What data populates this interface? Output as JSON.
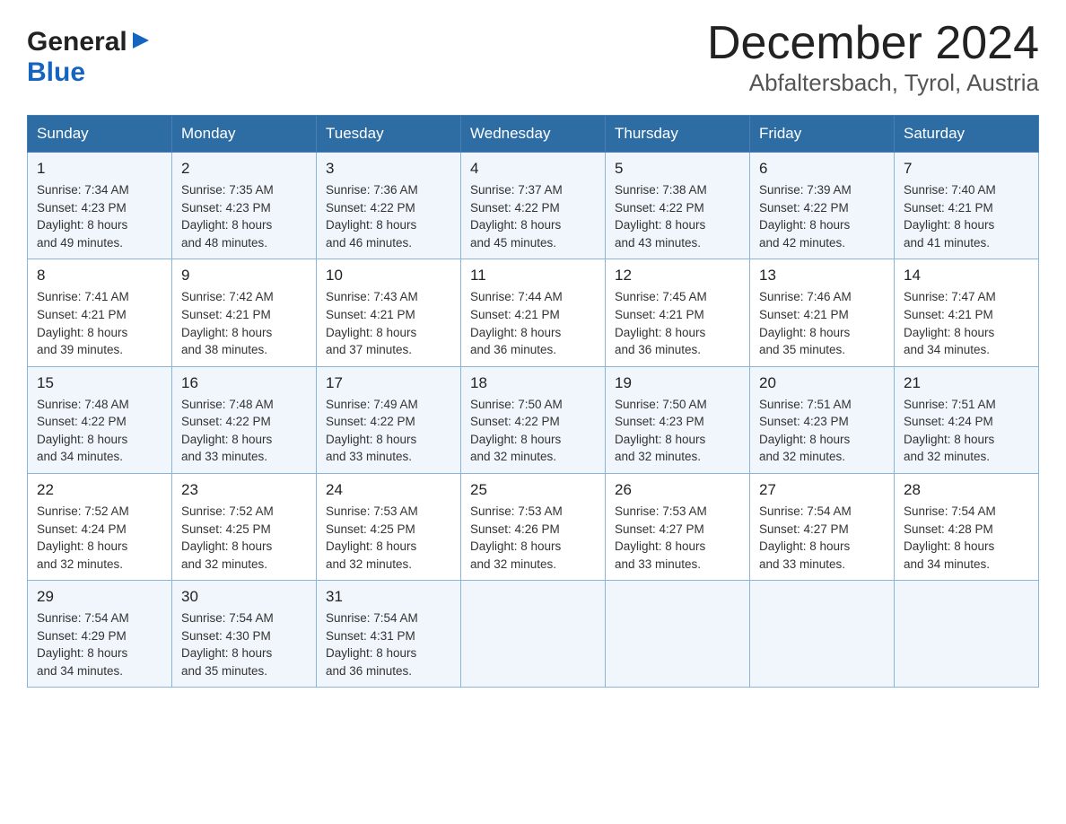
{
  "header": {
    "logo_general": "General",
    "logo_blue": "Blue",
    "month_title": "December 2024",
    "location": "Abfaltersbach, Tyrol, Austria"
  },
  "days_of_week": [
    "Sunday",
    "Monday",
    "Tuesday",
    "Wednesday",
    "Thursday",
    "Friday",
    "Saturday"
  ],
  "weeks": [
    [
      {
        "day": "1",
        "sunrise": "7:34 AM",
        "sunset": "4:23 PM",
        "daylight": "8 hours and 49 minutes."
      },
      {
        "day": "2",
        "sunrise": "7:35 AM",
        "sunset": "4:23 PM",
        "daylight": "8 hours and 48 minutes."
      },
      {
        "day": "3",
        "sunrise": "7:36 AM",
        "sunset": "4:22 PM",
        "daylight": "8 hours and 46 minutes."
      },
      {
        "day": "4",
        "sunrise": "7:37 AM",
        "sunset": "4:22 PM",
        "daylight": "8 hours and 45 minutes."
      },
      {
        "day": "5",
        "sunrise": "7:38 AM",
        "sunset": "4:22 PM",
        "daylight": "8 hours and 43 minutes."
      },
      {
        "day": "6",
        "sunrise": "7:39 AM",
        "sunset": "4:22 PM",
        "daylight": "8 hours and 42 minutes."
      },
      {
        "day": "7",
        "sunrise": "7:40 AM",
        "sunset": "4:21 PM",
        "daylight": "8 hours and 41 minutes."
      }
    ],
    [
      {
        "day": "8",
        "sunrise": "7:41 AM",
        "sunset": "4:21 PM",
        "daylight": "8 hours and 39 minutes."
      },
      {
        "day": "9",
        "sunrise": "7:42 AM",
        "sunset": "4:21 PM",
        "daylight": "8 hours and 38 minutes."
      },
      {
        "day": "10",
        "sunrise": "7:43 AM",
        "sunset": "4:21 PM",
        "daylight": "8 hours and 37 minutes."
      },
      {
        "day": "11",
        "sunrise": "7:44 AM",
        "sunset": "4:21 PM",
        "daylight": "8 hours and 36 minutes."
      },
      {
        "day": "12",
        "sunrise": "7:45 AM",
        "sunset": "4:21 PM",
        "daylight": "8 hours and 36 minutes."
      },
      {
        "day": "13",
        "sunrise": "7:46 AM",
        "sunset": "4:21 PM",
        "daylight": "8 hours and 35 minutes."
      },
      {
        "day": "14",
        "sunrise": "7:47 AM",
        "sunset": "4:21 PM",
        "daylight": "8 hours and 34 minutes."
      }
    ],
    [
      {
        "day": "15",
        "sunrise": "7:48 AM",
        "sunset": "4:22 PM",
        "daylight": "8 hours and 34 minutes."
      },
      {
        "day": "16",
        "sunrise": "7:48 AM",
        "sunset": "4:22 PM",
        "daylight": "8 hours and 33 minutes."
      },
      {
        "day": "17",
        "sunrise": "7:49 AM",
        "sunset": "4:22 PM",
        "daylight": "8 hours and 33 minutes."
      },
      {
        "day": "18",
        "sunrise": "7:50 AM",
        "sunset": "4:22 PM",
        "daylight": "8 hours and 32 minutes."
      },
      {
        "day": "19",
        "sunrise": "7:50 AM",
        "sunset": "4:23 PM",
        "daylight": "8 hours and 32 minutes."
      },
      {
        "day": "20",
        "sunrise": "7:51 AM",
        "sunset": "4:23 PM",
        "daylight": "8 hours and 32 minutes."
      },
      {
        "day": "21",
        "sunrise": "7:51 AM",
        "sunset": "4:24 PM",
        "daylight": "8 hours and 32 minutes."
      }
    ],
    [
      {
        "day": "22",
        "sunrise": "7:52 AM",
        "sunset": "4:24 PM",
        "daylight": "8 hours and 32 minutes."
      },
      {
        "day": "23",
        "sunrise": "7:52 AM",
        "sunset": "4:25 PM",
        "daylight": "8 hours and 32 minutes."
      },
      {
        "day": "24",
        "sunrise": "7:53 AM",
        "sunset": "4:25 PM",
        "daylight": "8 hours and 32 minutes."
      },
      {
        "day": "25",
        "sunrise": "7:53 AM",
        "sunset": "4:26 PM",
        "daylight": "8 hours and 32 minutes."
      },
      {
        "day": "26",
        "sunrise": "7:53 AM",
        "sunset": "4:27 PM",
        "daylight": "8 hours and 33 minutes."
      },
      {
        "day": "27",
        "sunrise": "7:54 AM",
        "sunset": "4:27 PM",
        "daylight": "8 hours and 33 minutes."
      },
      {
        "day": "28",
        "sunrise": "7:54 AM",
        "sunset": "4:28 PM",
        "daylight": "8 hours and 34 minutes."
      }
    ],
    [
      {
        "day": "29",
        "sunrise": "7:54 AM",
        "sunset": "4:29 PM",
        "daylight": "8 hours and 34 minutes."
      },
      {
        "day": "30",
        "sunrise": "7:54 AM",
        "sunset": "4:30 PM",
        "daylight": "8 hours and 35 minutes."
      },
      {
        "day": "31",
        "sunrise": "7:54 AM",
        "sunset": "4:31 PM",
        "daylight": "8 hours and 36 minutes."
      },
      null,
      null,
      null,
      null
    ]
  ],
  "labels": {
    "sunrise": "Sunrise:",
    "sunset": "Sunset:",
    "daylight": "Daylight:"
  }
}
